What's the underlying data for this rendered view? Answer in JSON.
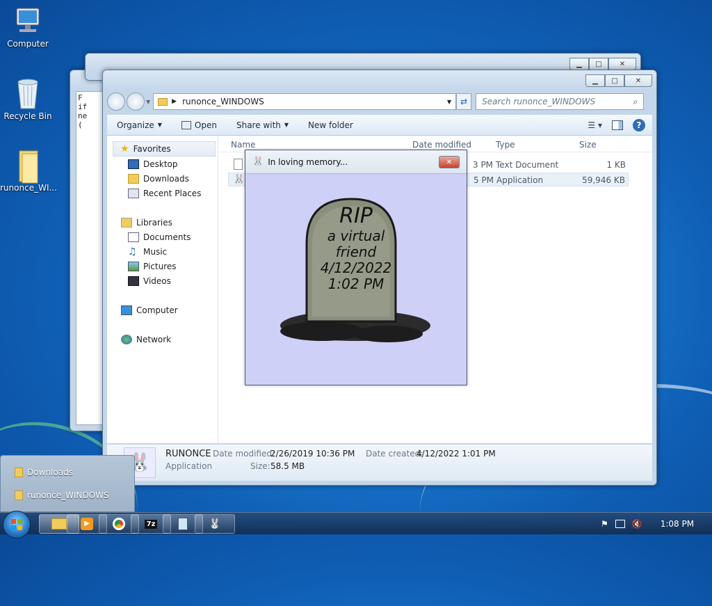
{
  "desktop": {
    "icons": [
      {
        "label": "Computer"
      },
      {
        "label": "Recycle Bin"
      },
      {
        "label": "runonce_WI..."
      }
    ]
  },
  "explorer": {
    "path": "runonce_WINDOWS",
    "search_placeholder": "Search runonce_WINDOWS",
    "toolbar": {
      "organize": "Organize",
      "open": "Open",
      "share_with": "Share with",
      "new_folder": "New folder"
    },
    "nav": {
      "favorites": "Favorites",
      "desktop": "Desktop",
      "downloads": "Downloads",
      "recent_places": "Recent Places",
      "libraries": "Libraries",
      "documents": "Documents",
      "music": "Music",
      "pictures": "Pictures",
      "videos": "Videos",
      "computer": "Computer",
      "network": "Network"
    },
    "columns": {
      "name": "Name",
      "date_modified": "Date modified",
      "type": "Type",
      "size": "Size"
    },
    "files": [
      {
        "date_tail": "3 PM",
        "type": "Text Document",
        "size": "1 KB"
      },
      {
        "date_tail": "5 PM",
        "type": "Application",
        "size": "59,946 KB"
      }
    ],
    "details": {
      "name": "RUNONCE",
      "kind": "Application",
      "date_modified_label": "Date modified:",
      "date_modified": "2/26/2019 10:36 PM",
      "date_created_label": "Date created:",
      "date_created": "4/12/2022 1:01 PM",
      "size_label": "Size:",
      "size": "58.5 MB"
    }
  },
  "back_window": {
    "snippet_lines": [
      "F",
      "if",
      "ne",
      "("
    ]
  },
  "rip_dialog": {
    "title": "In loving memory...",
    "stone": {
      "line1": "RIP",
      "line2": "a virtual",
      "line3": "friend",
      "line4": "4/12/2022",
      "line5": "1:02 PM"
    }
  },
  "jump_list": {
    "items": [
      {
        "label": "Downloads"
      },
      {
        "label": "runonce_WINDOWS"
      }
    ]
  },
  "tray": {
    "time": "1:08 PM"
  },
  "colors": {
    "rip_bg": "#cfd0f7",
    "close_red": "#c7432c"
  }
}
